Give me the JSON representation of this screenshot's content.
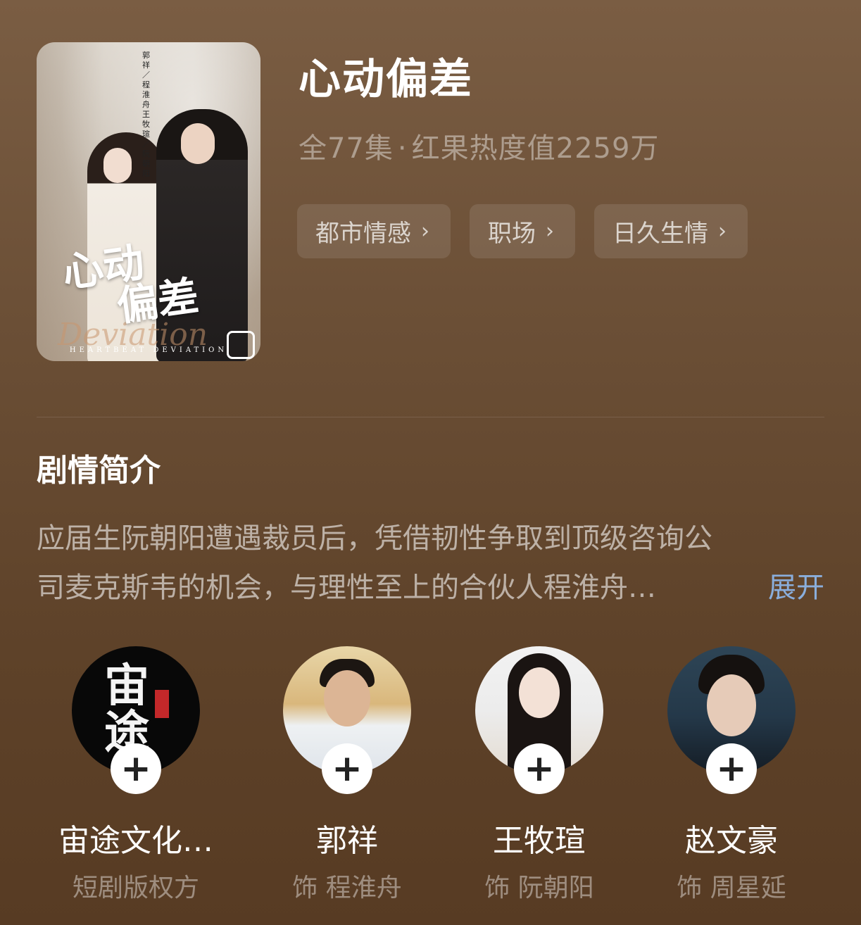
{
  "drama": {
    "title": "心动偏差",
    "episodes": "全77集",
    "separator": "·",
    "heat": "红果热度值2259万",
    "tags": [
      {
        "label": "都市情感",
        "chevron": "›"
      },
      {
        "label": "职场",
        "chevron": "›"
      },
      {
        "label": "日久生情",
        "chevron": "›"
      }
    ],
    "poster": {
      "title_line1": "心动",
      "title_line2": "偏差",
      "cursive": "Deviation",
      "subtitle": "HEARTBEAT DEVIATION",
      "cast_vertical": "郭祥／程淮舟 王牧瑄／阮朝阳"
    }
  },
  "synopsis": {
    "heading": "剧情简介",
    "line1": "应届生阮朝阳遭遇裁员后，凭借韧性争取到顶级咨询公",
    "line2": "司麦克斯韦的机会，与理性至上的合伙人程淮舟…",
    "expand": "展开"
  },
  "cast": [
    {
      "name": "宙途文化…",
      "role": "短剧版权方",
      "avatar": "logo",
      "logo_text": "宙途",
      "plus": "+"
    },
    {
      "name": "郭祥",
      "role": "饰 程淮舟",
      "avatar": "photo",
      "plus": "+"
    },
    {
      "name": "王牧瑄",
      "role": "饰 阮朝阳",
      "avatar": "photo",
      "plus": "+"
    },
    {
      "name": "赵文豪",
      "role": "饰 周星延",
      "avatar": "photo",
      "plus": "+"
    }
  ]
}
